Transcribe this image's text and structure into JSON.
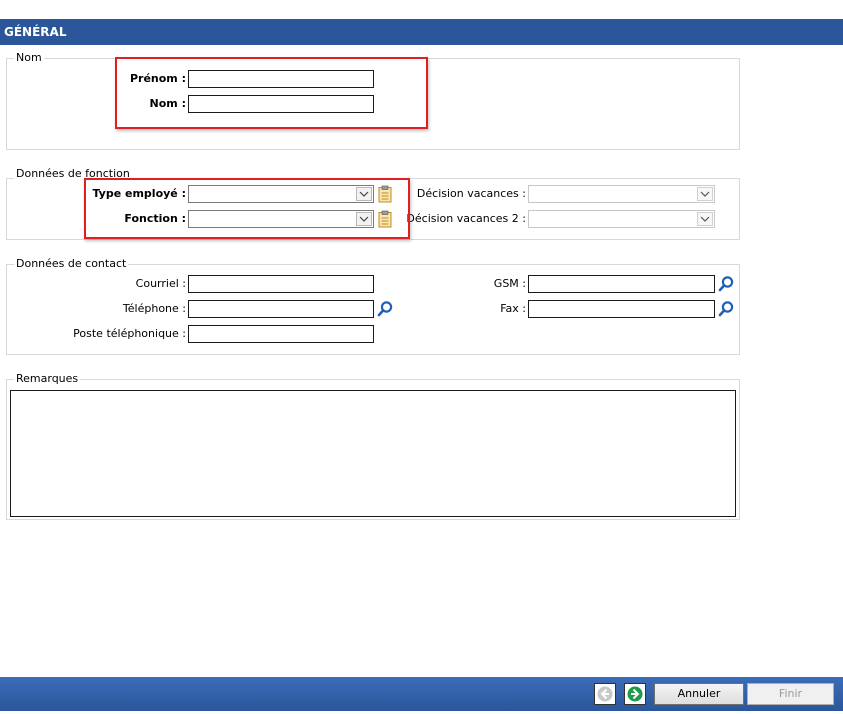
{
  "header": {
    "title": "GÉNÉRAL"
  },
  "nom_group": {
    "legend": "Nom",
    "prenom_label": "Prénom :",
    "prenom_value": "",
    "nom_label": "Nom :",
    "nom_value": ""
  },
  "fonction_group": {
    "legend": "Données de fonction",
    "type_employe_label": "Type employé :",
    "type_employe_value": "",
    "fonction_label": "Fonction :",
    "fonction_value": "",
    "decision_vacances_label": "Décision vacances :",
    "decision_vacances_value": "",
    "decision_vacances2_label": "Décision vacances 2 :",
    "decision_vacances2_value": ""
  },
  "contact_group": {
    "legend": "Données de contact",
    "courriel_label": "Courriel :",
    "courriel_value": "",
    "telephone_label": "Téléphone :",
    "telephone_value": "",
    "poste_label": "Poste téléphonique :",
    "poste_value": "",
    "gsm_label": "GSM :",
    "gsm_value": "",
    "fax_label": "Fax :",
    "fax_value": ""
  },
  "remarques_group": {
    "legend": "Remarques",
    "value": ""
  },
  "footer": {
    "cancel_label": "Annuler",
    "finish_label": "Finir"
  },
  "icons": {
    "clipboard": "clipboard-icon",
    "search": "search-icon",
    "prev": "arrow-left-icon",
    "next": "arrow-right-icon"
  },
  "colors": {
    "header": "#2b579a",
    "highlight": "#e02020",
    "next_arrow": "#1f9a4a"
  }
}
